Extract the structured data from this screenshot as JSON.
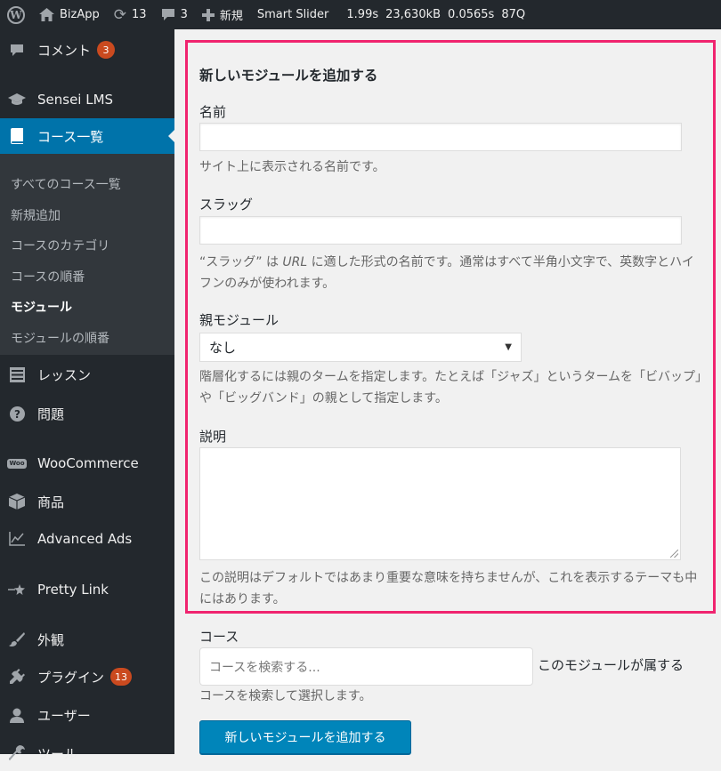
{
  "adminbar": {
    "site_name": "BizApp",
    "updates_count": "13",
    "comments_count": "3",
    "new_label": "新規",
    "smart_slider": "Smart Slider",
    "stats": [
      "1.99s",
      "23,630kB",
      "0.0565s",
      "87Q"
    ]
  },
  "sidebar": {
    "comments": {
      "label": "コメント",
      "badge": "3"
    },
    "sensei": {
      "label": "Sensei LMS"
    },
    "courses": {
      "label": "コース一覧"
    },
    "submenu": [
      "すべてのコース一覧",
      "新規追加",
      "コースのカテゴリ",
      "コースの順番",
      "モジュール",
      "モジュールの順番"
    ],
    "lessons": {
      "label": "レッスン"
    },
    "questions": {
      "label": "問題"
    },
    "woocommerce": {
      "label": "WooCommerce",
      "icon_text": "Woo"
    },
    "products": {
      "label": "商品"
    },
    "advanced_ads": {
      "label": "Advanced Ads"
    },
    "pretty_link": {
      "label": "Pretty Link"
    },
    "appearance": {
      "label": "外観"
    },
    "plugins": {
      "label": "プラグイン",
      "badge": "13"
    },
    "users": {
      "label": "ユーザー"
    },
    "tools": {
      "label": "ツール"
    }
  },
  "form": {
    "title": "新しいモジュールを追加する",
    "name_label": "名前",
    "name_desc": "サイト上に表示される名前です。",
    "slug_label": "スラッグ",
    "slug_desc_part1": "“スラッグ” は ",
    "slug_desc_url": "URL",
    "slug_desc_part2": " に適した形式の名前です。通常はすべて半角小文字で、英数字とハイフンのみが使われます。",
    "parent_label": "親モジュール",
    "parent_selected": "なし",
    "parent_desc": "階層化するには親のタームを指定します。たとえば「ジャズ」というタームを「ビバップ」や「ビッグバンド」の親として指定します。",
    "description_label": "説明",
    "description_desc": "この説明はデフォルトではあまり重要な意味を持ちませんが、これを表示するテーマも中にはあります。",
    "course_label": "コース",
    "course_placeholder": "コースを検索する...",
    "course_inline_note": "このモジュールが属する",
    "course_desc": "コースを検索して選択します。",
    "submit_label": "新しいモジュールを追加する"
  },
  "colors": {
    "highlight_border": "#f0246f",
    "primary_button": "#0085ba",
    "current_menu": "#0073aa",
    "badge": "#ca4a1f"
  }
}
